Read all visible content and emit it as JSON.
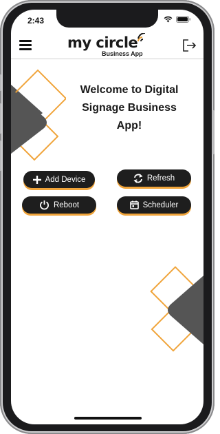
{
  "status_bar": {
    "time": "2:43"
  },
  "app_bar": {
    "logo_main": "my circle",
    "logo_sub": "Business App"
  },
  "welcome": {
    "line1": "Welcome to Digital",
    "line2": "Signage Business",
    "line3": "App!"
  },
  "actions": {
    "add_device": {
      "label": "Add Device",
      "icon": "plus-icon"
    },
    "refresh": {
      "label": "Refresh",
      "icon": "refresh-icon"
    },
    "reboot": {
      "label": "Reboot",
      "icon": "power-icon"
    },
    "scheduler": {
      "label": "Scheduler",
      "icon": "calendar-icon"
    }
  },
  "colors": {
    "accent": "#f0a43a",
    "button_bg": "#1e1e1e",
    "decor_dark": "#555555"
  }
}
